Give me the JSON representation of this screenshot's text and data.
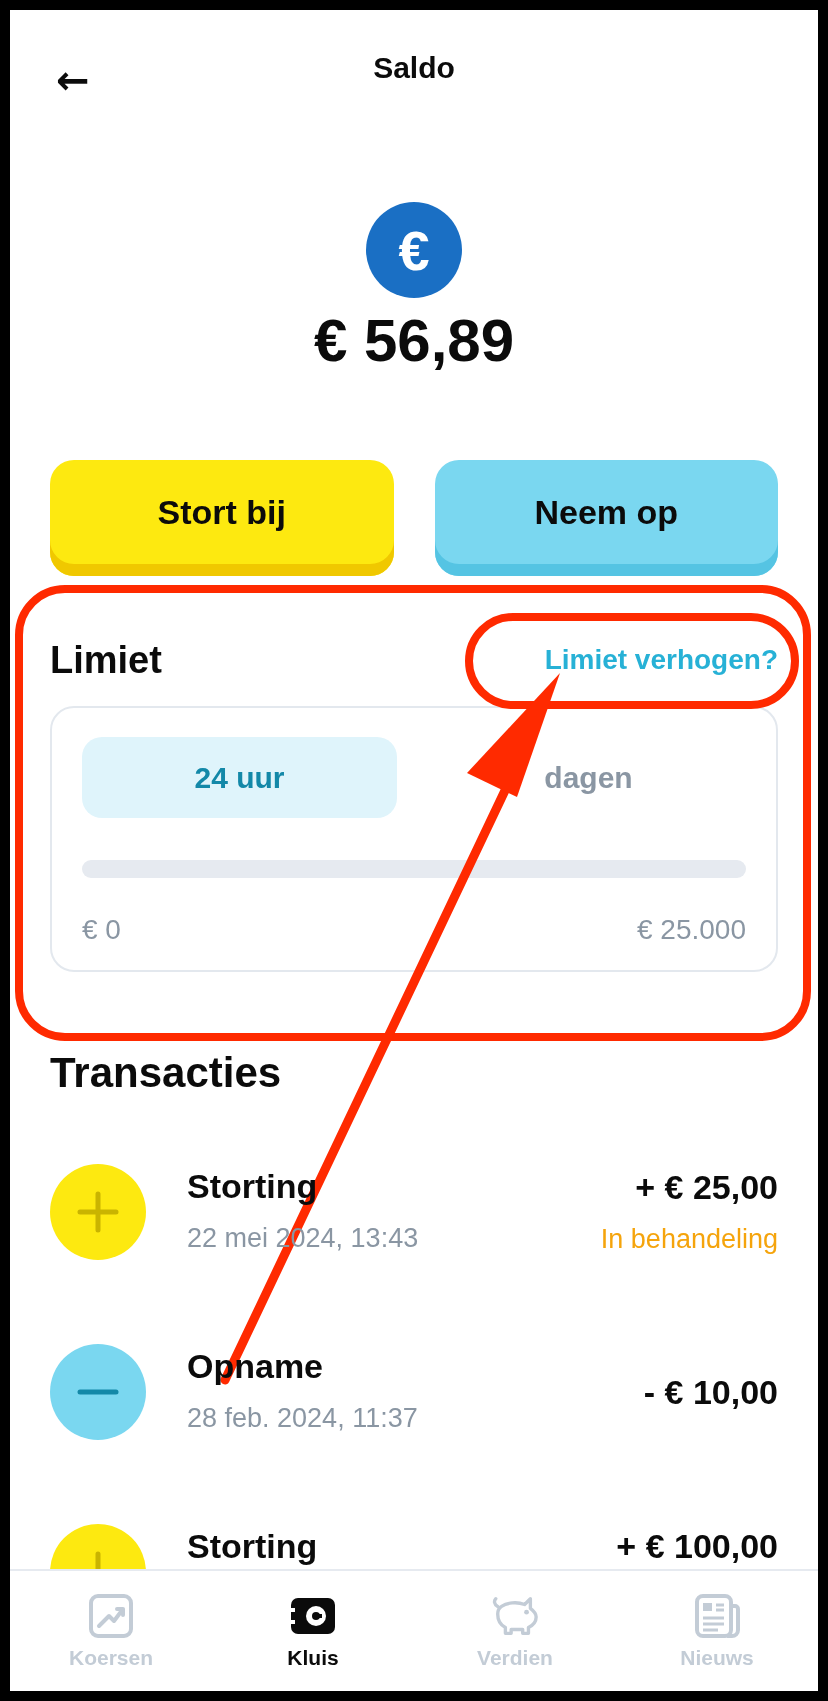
{
  "header": {
    "back": "←",
    "title": "Saldo"
  },
  "balance": {
    "symbol": "€",
    "amount": "€ 56,89"
  },
  "actions": [
    {
      "label": "Stort bij",
      "kind": "deposit"
    },
    {
      "label": "Neem op",
      "kind": "withdraw"
    }
  ],
  "limit": {
    "title": "Limiet",
    "link": "Limiet verhogen?",
    "tabs": [
      {
        "label": "24 uur",
        "selected": true
      },
      {
        "label": "dagen",
        "selected": false
      }
    ],
    "level": 0,
    "min_label": "€ 0",
    "max_label": "€ 25.000"
  },
  "transactions": {
    "title": "Transacties",
    "items": [
      {
        "kind": "deposit",
        "title": "Storting",
        "date": "22 mei 2024, 13:43",
        "amount": "+ € 25,00",
        "status": "In behandeling"
      },
      {
        "kind": "withdraw",
        "title": "Opname",
        "date": "28 feb. 2024, 11:37",
        "amount": "- € 10,00"
      },
      {
        "kind": "deposit",
        "title": "Storting",
        "amount": "+ € 100,00"
      }
    ]
  },
  "nav": [
    {
      "label": "Koersen",
      "selected": false
    },
    {
      "label": "Kluis",
      "selected": true
    },
    {
      "label": "Verdien",
      "selected": false
    },
    {
      "label": "Nieuws",
      "selected": false
    }
  ],
  "annotations": [
    {
      "kind": "frame"
    },
    {
      "kind": "oval"
    },
    {
      "kind": "arrow"
    }
  ]
}
